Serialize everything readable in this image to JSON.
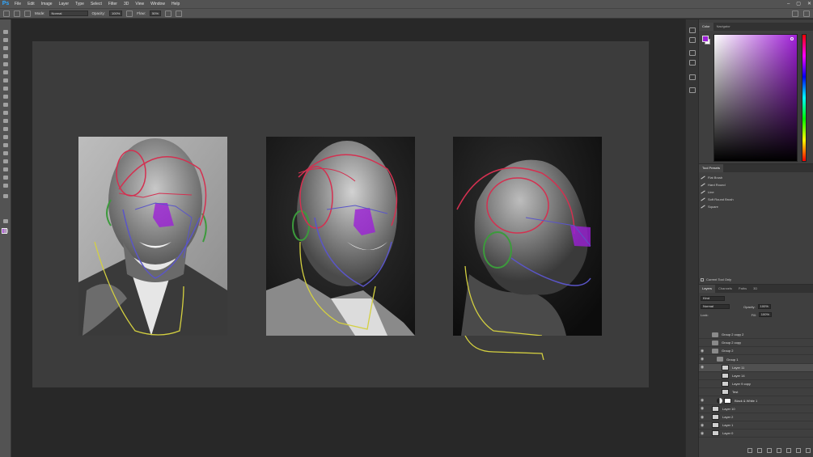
{
  "app": {
    "logo": "Ps"
  },
  "menu": [
    "File",
    "Edit",
    "Image",
    "Layer",
    "Type",
    "Select",
    "Filter",
    "3D",
    "View",
    "Window",
    "Help"
  ],
  "window_controls": [
    "–",
    "▢",
    "✕"
  ],
  "options_bar": {
    "mode_label": "Mode:",
    "mode_value": "Normal",
    "opacity_label": "Opacity:",
    "opacity_value": "100%",
    "flow_label": "Flow:",
    "flow_value": "50%"
  },
  "colors": {
    "foreground": "#9b20d6",
    "background": "#ffffff",
    "accent": "#31a8ff"
  },
  "color_panel": {
    "tabs": [
      "Color",
      "Navigator"
    ]
  },
  "tool_presets": {
    "title": "Tool Presets",
    "items": [
      "Flat Brush",
      "Hard Round",
      "Line",
      "Soft Round Brush",
      "Square"
    ],
    "current_tool_only": "Current Tool Only"
  },
  "layers_panel": {
    "tabs": [
      "Layers",
      "Channels",
      "Paths",
      "3D"
    ],
    "filter": "Kind",
    "blend": "Normal",
    "opacity_label": "Opacity:",
    "opacity_value": "100%",
    "lock_label": "Lock:",
    "fill_label": "Fill:",
    "fill_value": "100%",
    "layers": [
      {
        "name": "Group 2 copy 2",
        "kind": "group",
        "visible": false,
        "selected": false
      },
      {
        "name": "Group 2 copy",
        "kind": "group",
        "visible": false,
        "selected": false
      },
      {
        "name": "Group 2",
        "kind": "group",
        "visible": true,
        "selected": false
      },
      {
        "name": "Group 1",
        "kind": "group",
        "visible": true,
        "selected": false
      },
      {
        "name": "Layer 11",
        "kind": "layer",
        "visible": true,
        "selected": true
      },
      {
        "name": "Layer 14",
        "kind": "layer",
        "visible": false,
        "selected": false
      },
      {
        "name": "Layer 9 copy",
        "kind": "layer",
        "visible": false,
        "selected": false
      },
      {
        "name": "Test",
        "kind": "layer",
        "visible": false,
        "selected": false
      },
      {
        "name": "Black & White 1",
        "kind": "adjustment",
        "visible": true,
        "selected": false
      },
      {
        "name": "Layer 10",
        "kind": "layer",
        "visible": true,
        "selected": false
      },
      {
        "name": "Layer 2",
        "kind": "layer",
        "visible": true,
        "selected": false
      },
      {
        "name": "Layer 1",
        "kind": "layer",
        "visible": true,
        "selected": false
      },
      {
        "name": "Layer 0",
        "kind": "layer",
        "visible": true,
        "selected": false
      }
    ]
  }
}
